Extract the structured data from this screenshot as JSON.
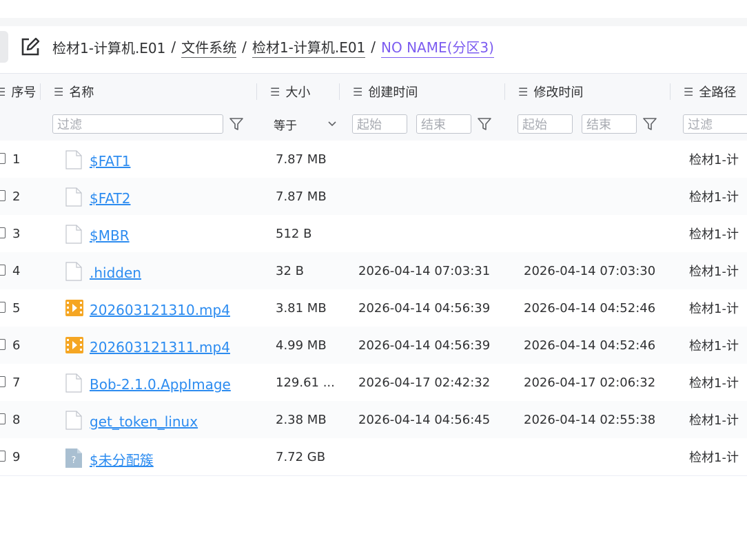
{
  "breadcrumb": {
    "items": [
      {
        "label": "检材1-计算机.E01",
        "style": "plain"
      },
      {
        "label": "文件系统",
        "style": "ul"
      },
      {
        "label": "检材1-计算机.E01",
        "style": "ul"
      },
      {
        "label": "NO NAME(分区3)",
        "style": "active"
      }
    ],
    "separator": "/"
  },
  "columns": {
    "index": "序号",
    "name": "名称",
    "size": "大小",
    "created": "创建时间",
    "modified": "修改时间",
    "path": "全路径"
  },
  "filters": {
    "name_placeholder": "过滤",
    "size_op": "等于",
    "created_start": "起始",
    "created_end": "结束",
    "modified_start": "起始",
    "modified_end": "结束",
    "path_placeholder": "过滤"
  },
  "rows": [
    {
      "index": "1",
      "name": "$FAT1",
      "icon": "file-icon",
      "size": "7.87 MB",
      "created": "",
      "modified": "",
      "path": "检材1-计"
    },
    {
      "index": "2",
      "name": "$FAT2",
      "icon": "file-icon",
      "size": "7.87 MB",
      "created": "",
      "modified": "",
      "path": "检材1-计"
    },
    {
      "index": "3",
      "name": "$MBR",
      "icon": "file-icon",
      "size": "512 B",
      "created": "",
      "modified": "",
      "path": "检材1-计"
    },
    {
      "index": "4",
      "name": ".hidden",
      "icon": "file-icon",
      "size": "32 B",
      "created": "2026-04-14 07:03:31",
      "modified": "2026-04-14 07:03:30",
      "path": "检材1-计"
    },
    {
      "index": "5",
      "name": "202603121310.mp4",
      "icon": "video-icon",
      "size": "3.81 MB",
      "created": "2026-04-14 04:56:39",
      "modified": "2026-04-14 04:52:46",
      "path": "检材1-计"
    },
    {
      "index": "6",
      "name": "202603121311.mp4",
      "icon": "video-icon",
      "size": "4.99 MB",
      "created": "2026-04-14 04:56:39",
      "modified": "2026-04-14 04:52:46",
      "path": "检材1-计"
    },
    {
      "index": "7",
      "name": "Bob-2.1.0.AppImage",
      "icon": "file-icon",
      "size": "129.61 ...",
      "created": "2026-04-17 02:42:32",
      "modified": "2026-04-17 02:06:32",
      "path": "检材1-计"
    },
    {
      "index": "8",
      "name": "get_token_linux",
      "icon": "file-icon",
      "size": "2.38 MB",
      "created": "2026-04-14 04:56:45",
      "modified": "2026-04-14 02:55:38",
      "path": "检材1-计"
    },
    {
      "index": "9",
      "name": "$未分配簇",
      "icon": "unknown-file-icon",
      "size": "7.72 GB",
      "created": "",
      "modified": "",
      "path": "检材1-计"
    }
  ],
  "colors": {
    "link": "#2d8cf0",
    "active_crumb": "#7c5cf0",
    "video": "#f5a623",
    "highlight_border": "#9b8cf0"
  }
}
